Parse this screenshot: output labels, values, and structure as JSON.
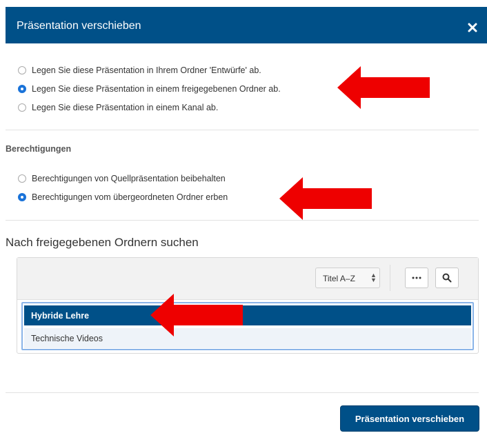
{
  "dialog": {
    "title": "Präsentation verschieben",
    "close_icon": "close-icon",
    "header_color": "#005088"
  },
  "location_options": [
    {
      "label": "Legen Sie diese Präsentation in Ihrem Ordner 'Entwürfe' ab.",
      "selected": false
    },
    {
      "label": "Legen Sie diese Präsentation in einem freigegebenen Ordner ab.",
      "selected": true
    },
    {
      "label": "Legen Sie diese Präsentation in einem Kanal ab.",
      "selected": false
    }
  ],
  "permissions": {
    "heading": "Berechtigungen",
    "options": [
      {
        "label": "Berechtigungen von Quellpräsentation beibehalten",
        "selected": false
      },
      {
        "label": "Berechtigungen vom übergeordneten Ordner erben",
        "selected": true
      }
    ]
  },
  "folder_search": {
    "title": "Nach freigegebenen Ordnern suchen",
    "sort_value": "Titel A–Z",
    "more_icon": "more-icon",
    "search_icon": "search-icon",
    "folders": [
      {
        "label": "Hybride Lehre",
        "selected": true
      },
      {
        "label": "Technische Videos",
        "selected": false
      }
    ]
  },
  "footer": {
    "submit_label": "Präsentation verschieben"
  },
  "annotations": {
    "arrow_color": "#ee0000",
    "arrow_icon": "red-arrow-icon"
  }
}
